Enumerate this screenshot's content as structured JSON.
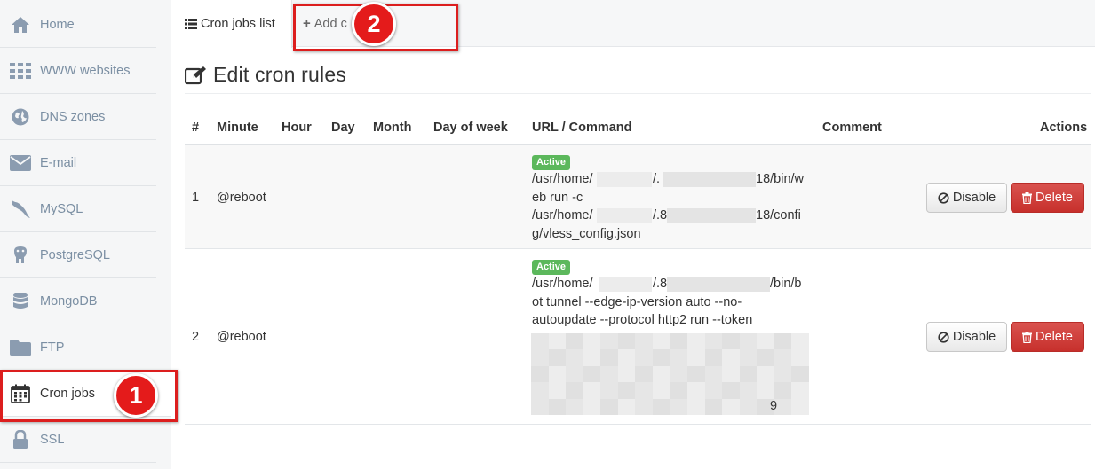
{
  "sidebar": {
    "items": [
      {
        "label": "Home",
        "icon": "home-icon"
      },
      {
        "label": "WWW websites",
        "icon": "grid-icon"
      },
      {
        "label": "DNS zones",
        "icon": "globe-icon"
      },
      {
        "label": "E-mail",
        "icon": "envelope-icon"
      },
      {
        "label": "MySQL",
        "icon": "dolphin-icon"
      },
      {
        "label": "PostgreSQL",
        "icon": "elephant-icon"
      },
      {
        "label": "MongoDB",
        "icon": "database-icon"
      },
      {
        "label": "FTP",
        "icon": "folder-icon"
      },
      {
        "label": "Cron jobs",
        "icon": "calendar-icon"
      },
      {
        "label": "SSL",
        "icon": "lock-icon"
      }
    ],
    "active": "Cron jobs"
  },
  "tabs": {
    "list_label": "Cron jobs list",
    "add_label": "Add c"
  },
  "annotations": {
    "badge1": "1",
    "badge2": "2"
  },
  "page": {
    "title": "Edit cron rules"
  },
  "table": {
    "headers": {
      "num": "#",
      "minute": "Minute",
      "hour": "Hour",
      "day": "Day",
      "month": "Month",
      "day_of_week": "Day of week",
      "command": "URL / Command",
      "comment": "Comment",
      "actions": "Actions"
    },
    "rows": [
      {
        "num": "1",
        "minute": "@reboot",
        "status": "Active",
        "cmd": {
          "l1a": "/usr/home/",
          "l1b": "/.",
          "l1c": "18/bin/w",
          "l2": "eb run -c",
          "l3a": "/usr/home/",
          "l3b": "/.8",
          "l3c": "18/confi",
          "l4": "g/vless_config.json"
        },
        "disable_label": "Disable",
        "delete_label": "Delete"
      },
      {
        "num": "2",
        "minute": "@reboot",
        "status": "Active",
        "cmd": {
          "l1a": "/usr/home/",
          "l1b": "/.8",
          "l1c": "/bin/b",
          "l2": "ot tunnel --edge-ip-version auto --no-",
          "l3": "autoupdate --protocol http2 run --token",
          "l_end": "9"
        },
        "disable_label": "Disable",
        "delete_label": "Delete"
      }
    ]
  },
  "colors": {
    "annotation_red": "#e41b1b",
    "status_green": "#5cb85c",
    "delete_red": "#d9534f",
    "sidebar_text": "#7b8fa3"
  }
}
